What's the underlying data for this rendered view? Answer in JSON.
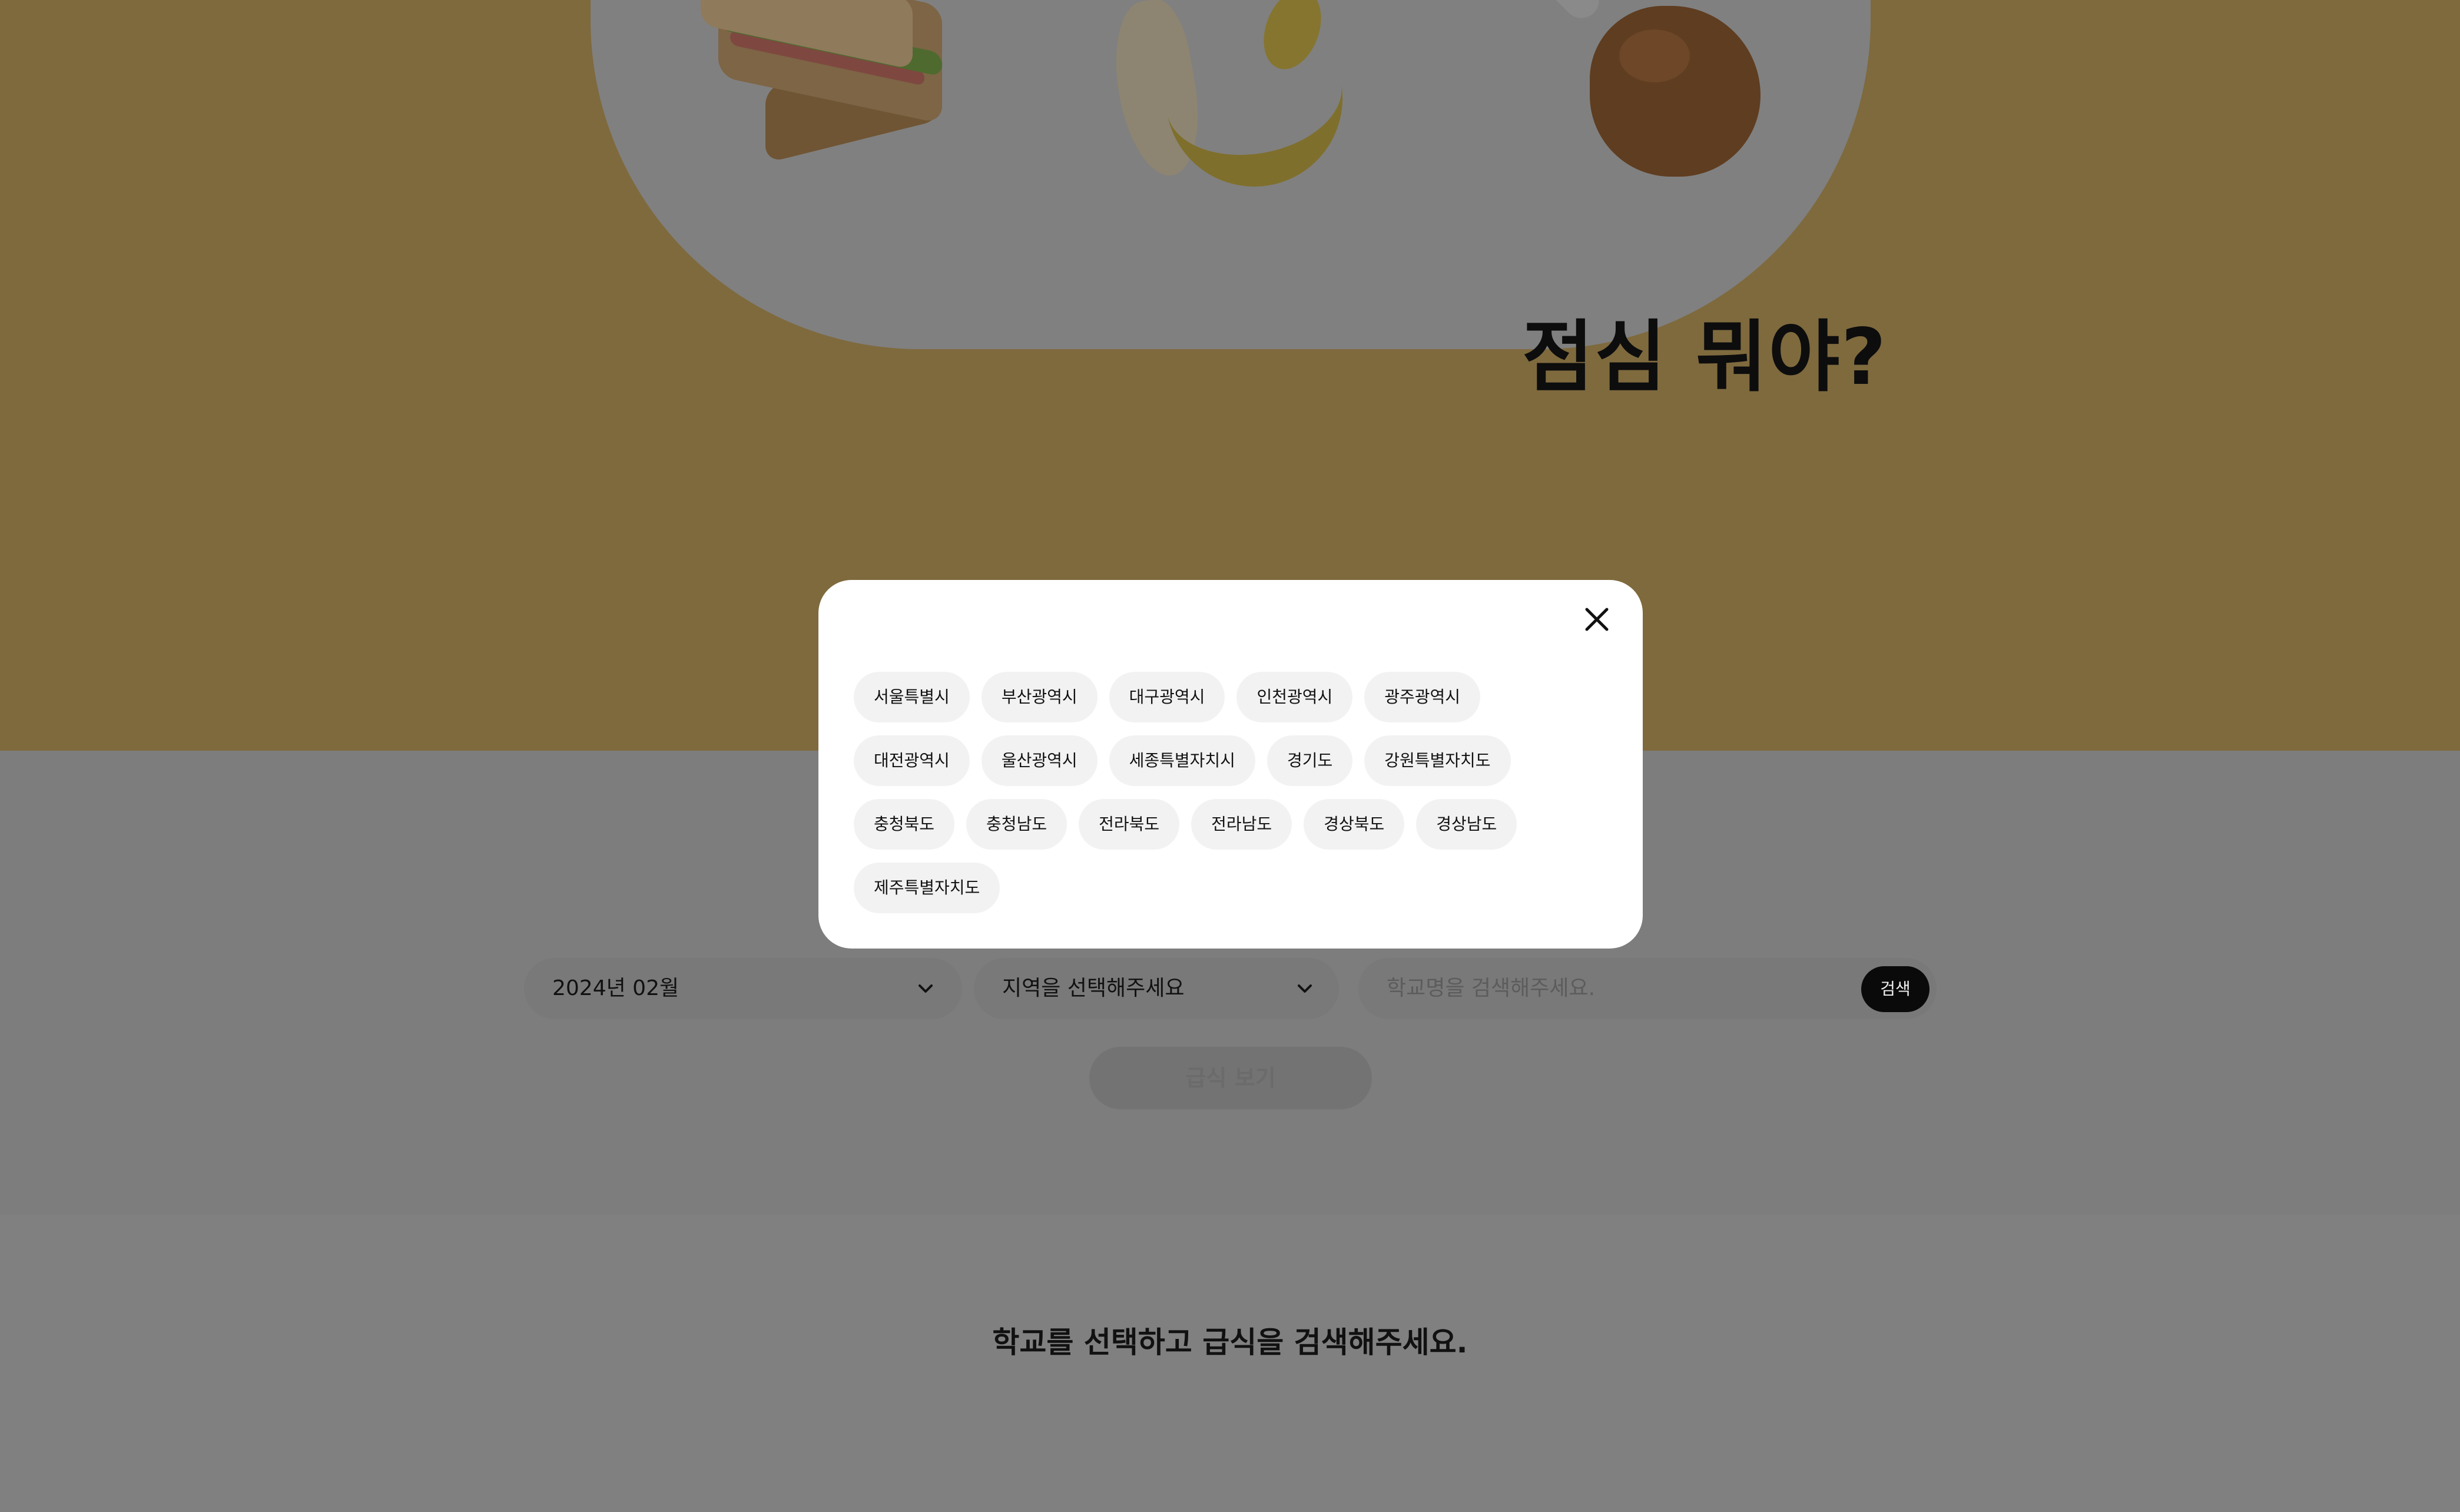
{
  "hero": {
    "title": "점심 뭐야?"
  },
  "search": {
    "month_value": "2024년 02월",
    "region_placeholder": "지역을 선택해주세요",
    "school_placeholder": "학교명을 검색해주세요.",
    "search_button": "검색",
    "view_meal_button": "급식 보기"
  },
  "modal": {
    "regions": [
      "서울특별시",
      "부산광역시",
      "대구광역시",
      "인천광역시",
      "광주광역시",
      "대전광역시",
      "울산광역시",
      "세종특별자치시",
      "경기도",
      "강원특별자치도",
      "충청북도",
      "충청남도",
      "전라북도",
      "전라남도",
      "경상북도",
      "경상남도",
      "제주특별자치도"
    ]
  },
  "result": {
    "message": "학교를 선택하고 급식을 검색해주세요."
  },
  "colors": {
    "accent_yellow": "#f5c245",
    "overlay": "rgba(0,0,0,0.5)",
    "button_dark": "#111111"
  },
  "icons": {
    "close": "close-icon",
    "dropdown": "chevron-down-icon"
  }
}
